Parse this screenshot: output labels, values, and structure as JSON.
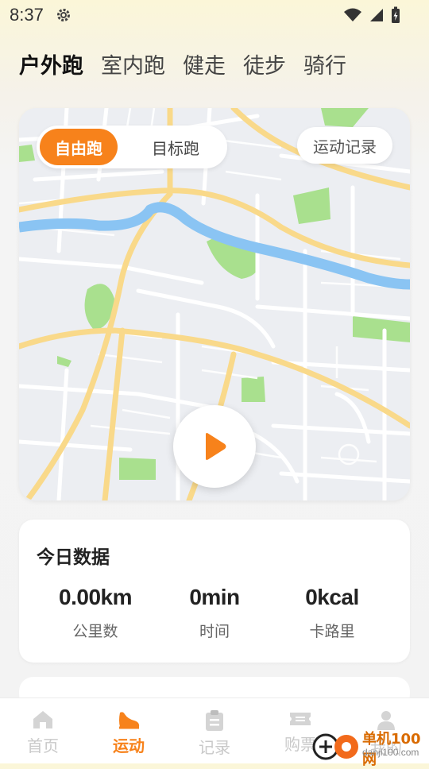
{
  "status": {
    "time": "8:37"
  },
  "sport_tabs": [
    {
      "label": "户外跑",
      "active": true
    },
    {
      "label": "室内跑",
      "active": false
    },
    {
      "label": "健走",
      "active": false
    },
    {
      "label": "徒步",
      "active": false
    },
    {
      "label": "骑行",
      "active": false
    }
  ],
  "map": {
    "mode_free": "自由跑",
    "mode_target": "目标跑",
    "record_label": "运动记录"
  },
  "today": {
    "title": "今日数据",
    "stats": [
      {
        "value": "0.00km",
        "label": "公里数"
      },
      {
        "value": "0min",
        "label": "时间"
      },
      {
        "value": "0kcal",
        "label": "卡路里"
      }
    ]
  },
  "bottom_nav": [
    {
      "label": "首页",
      "icon": "home-icon",
      "active": false
    },
    {
      "label": "运动",
      "icon": "shoe-icon",
      "active": true
    },
    {
      "label": "记录",
      "icon": "clipboard-icon",
      "active": false
    },
    {
      "label": "购票",
      "icon": "ticket-icon",
      "active": false
    },
    {
      "label": "我的",
      "icon": "user-icon",
      "active": false
    }
  ],
  "watermark": {
    "text": "单机100网",
    "sub": "danji100.com"
  },
  "colors": {
    "accent": "#f7821b",
    "river": "#8ac4f3",
    "road_major": "#f9d98a",
    "park": "#a9e08e"
  }
}
